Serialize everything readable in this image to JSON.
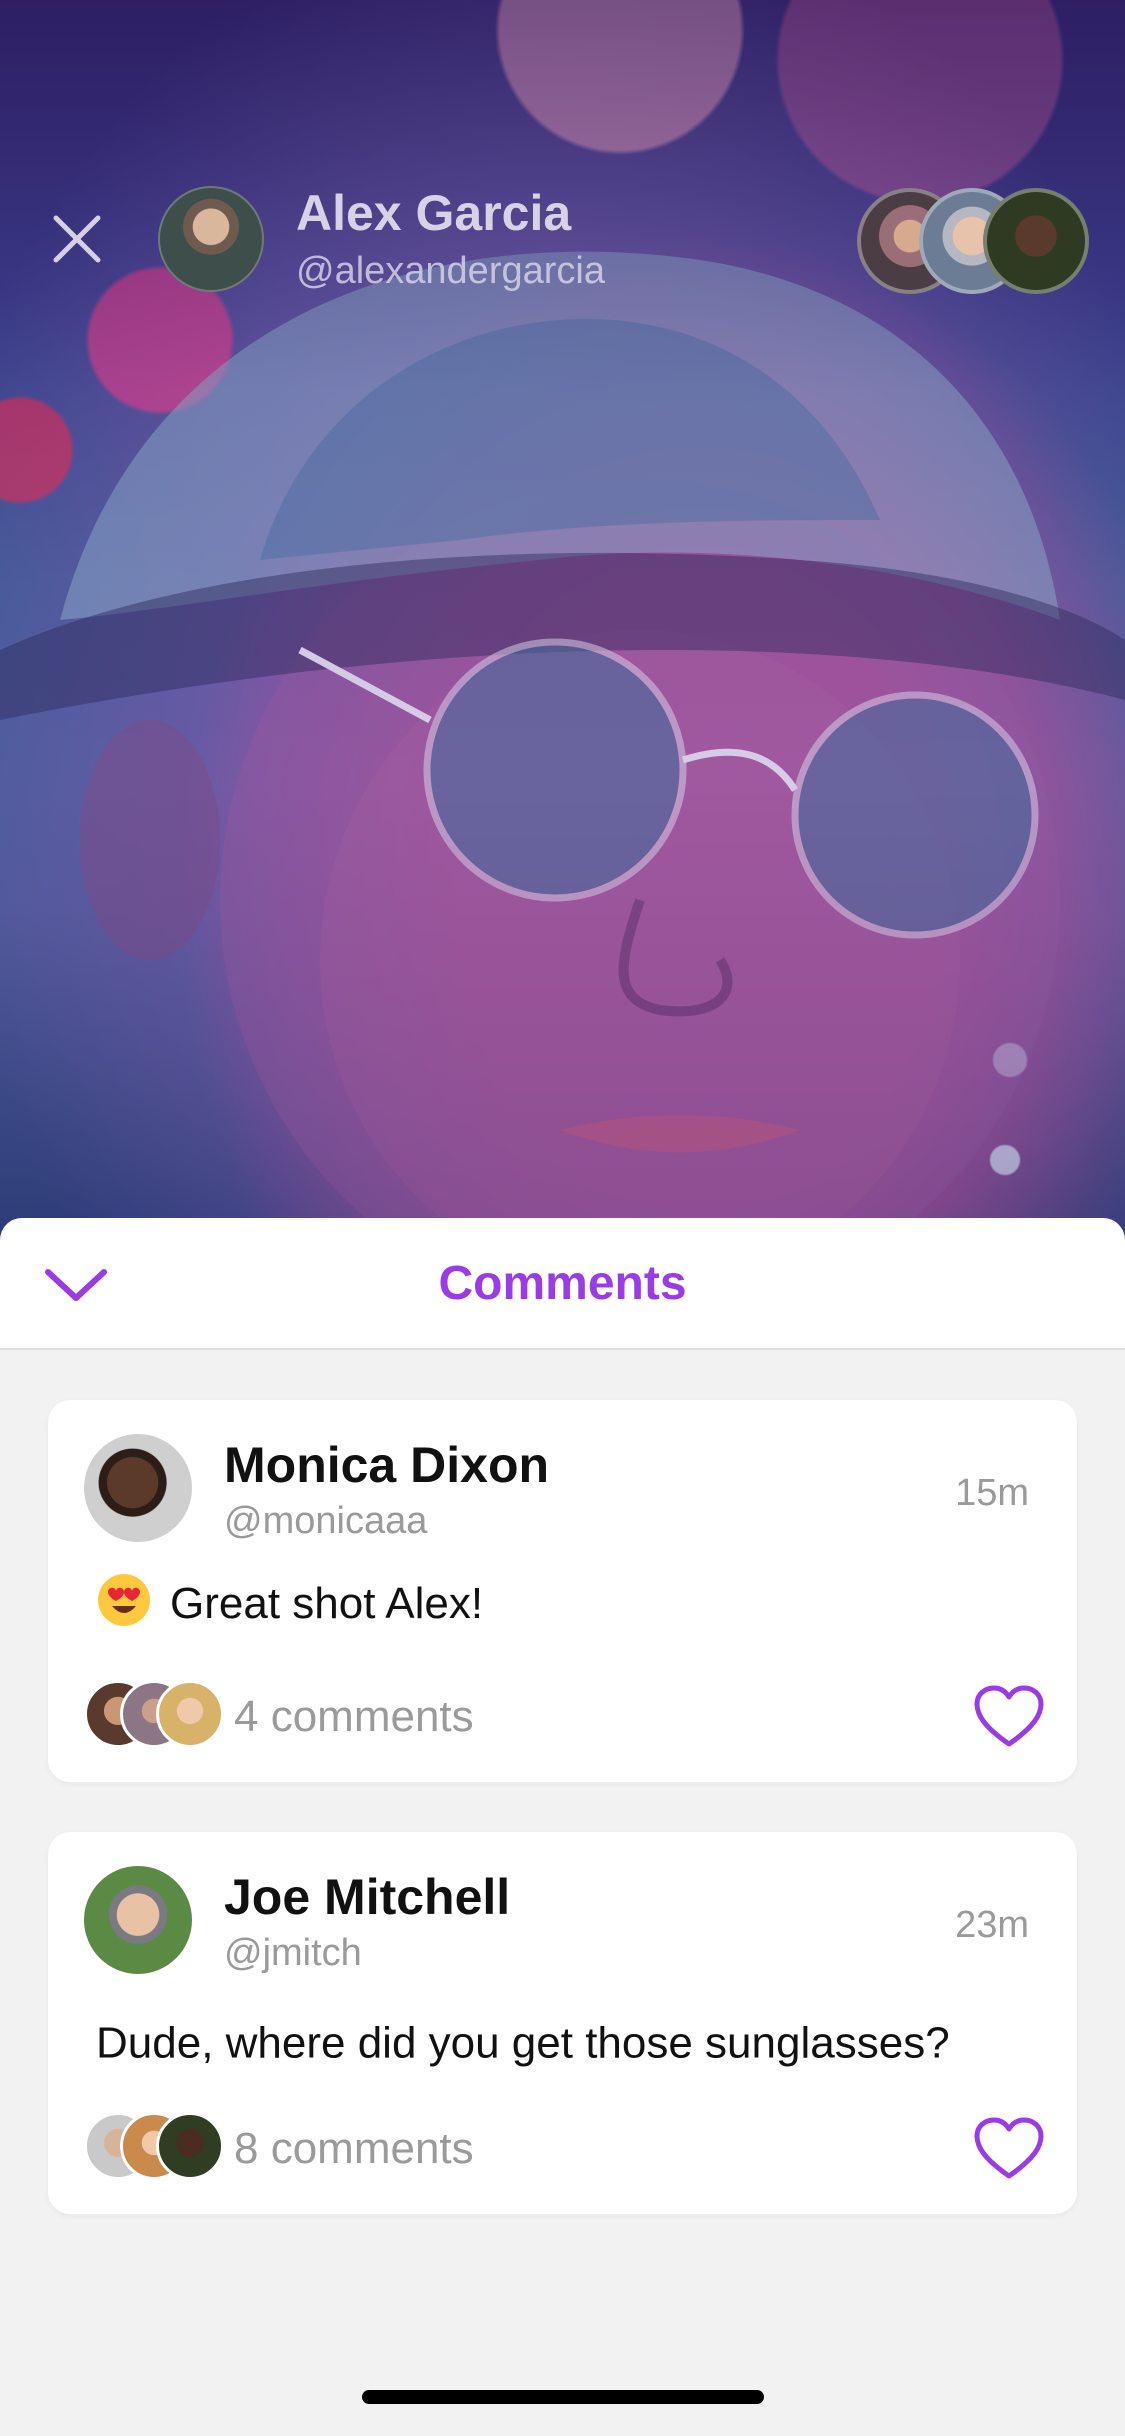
{
  "colors": {
    "accent": "#9b3be6",
    "text_primary": "#111111",
    "text_secondary": "#9a9a9a",
    "background": "#f2f2f2",
    "card": "#ffffff"
  },
  "post": {
    "author_name": "Alex Garcia",
    "author_handle": "@alexandergarcia",
    "icons": {
      "close": "close-icon"
    }
  },
  "sheet": {
    "title": "Comments",
    "collapse_icon": "chevron-down-icon"
  },
  "comments": [
    {
      "name": "Monica Dixon",
      "handle": "@monicaaa",
      "time": "15m",
      "emoji": "heart-eyes-emoji",
      "text": "Great shot Alex!",
      "reply_count": "4 comments",
      "like_icon": "heart-outline-icon"
    },
    {
      "name": "Joe Mitchell",
      "handle": "@jmitch",
      "time": "23m",
      "text": "Dude, where did you get those sunglasses?",
      "reply_count": "8 comments",
      "like_icon": "heart-outline-icon"
    }
  ]
}
